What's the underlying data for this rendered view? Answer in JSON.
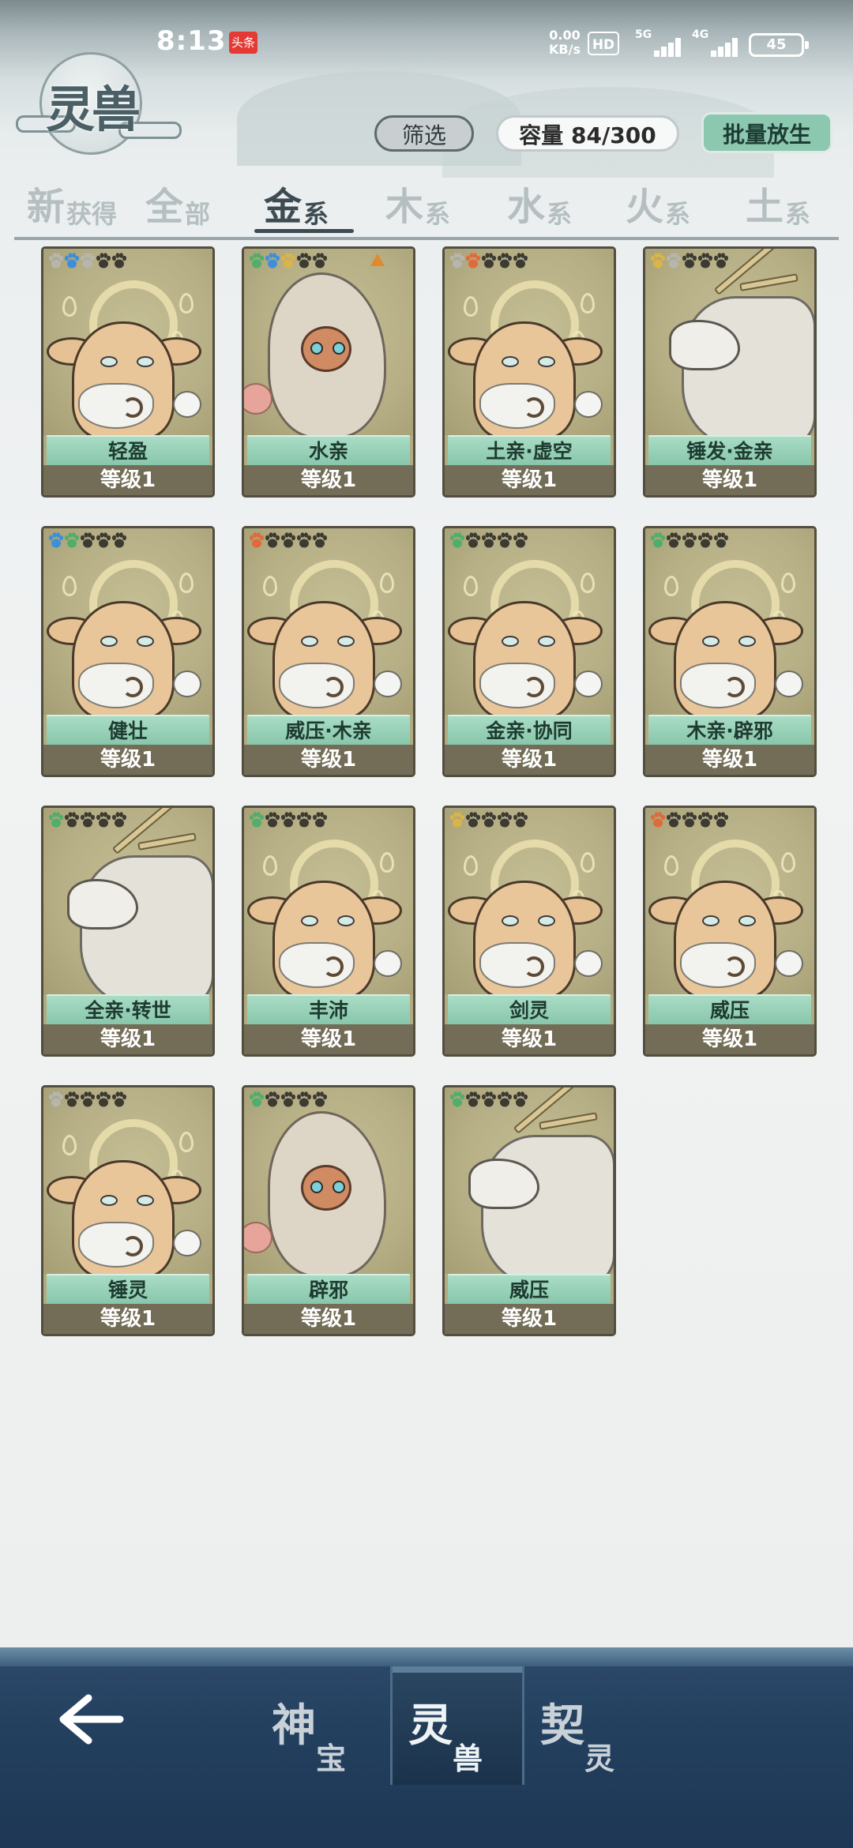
{
  "status_bar": {
    "time": "8:13",
    "news_badge": "头条",
    "net_speed_value": "0.00",
    "net_speed_unit": "KB/s",
    "hd": "HD",
    "signal_1": "5G",
    "signal_2": "4G",
    "battery": "45"
  },
  "header": {
    "title": "灵兽",
    "filter_label": "筛选",
    "capacity_label": "容量 84/300",
    "batch_release_label": "批量放生"
  },
  "tabs": [
    {
      "big": "新",
      "small": "获得",
      "active": false
    },
    {
      "big": "全",
      "small": "部",
      "active": false
    },
    {
      "big": "金",
      "small": "系",
      "active": true
    },
    {
      "big": "木",
      "small": "系",
      "active": false
    },
    {
      "big": "水",
      "small": "系",
      "active": false
    },
    {
      "big": "火",
      "small": "系",
      "active": false
    },
    {
      "big": "土",
      "small": "系",
      "active": false
    }
  ],
  "colors": {
    "gold": "#d9b44a",
    "wood": "#4fae6a",
    "water": "#3c8fd8",
    "fire": "#e06a3a",
    "earth": "#b6b6b0",
    "empty": "#3b3a33"
  },
  "cards": [
    {
      "name": "轻盈",
      "level": "等级1",
      "beast": "rabbit",
      "paws": [
        "earth",
        "water",
        "earth",
        "empty",
        "empty"
      ],
      "triangle": false
    },
    {
      "name": "水亲",
      "level": "等级1",
      "beast": "monkey",
      "paws": [
        "wood",
        "water",
        "gold",
        "empty",
        "empty"
      ],
      "triangle": true
    },
    {
      "name": "土亲·虚空",
      "level": "等级1",
      "beast": "rabbit",
      "paws": [
        "earth",
        "fire",
        "empty",
        "empty",
        "empty"
      ],
      "triangle": false
    },
    {
      "name": "锤发·金亲",
      "level": "等级1",
      "beast": "qilin",
      "paws": [
        "gold",
        "earth",
        "empty",
        "empty",
        "empty"
      ],
      "triangle": false
    },
    {
      "name": "健壮",
      "level": "等级1",
      "beast": "rabbit",
      "paws": [
        "water",
        "wood",
        "empty",
        "empty",
        "empty"
      ],
      "triangle": false
    },
    {
      "name": "威压·木亲",
      "level": "等级1",
      "beast": "rabbit",
      "paws": [
        "fire",
        "empty",
        "empty",
        "empty",
        "empty"
      ],
      "triangle": false
    },
    {
      "name": "金亲·协同",
      "level": "等级1",
      "beast": "rabbit",
      "paws": [
        "wood",
        "empty",
        "empty",
        "empty",
        "empty"
      ],
      "triangle": false
    },
    {
      "name": "木亲·辟邪",
      "level": "等级1",
      "beast": "rabbit",
      "paws": [
        "wood",
        "empty",
        "empty",
        "empty",
        "empty"
      ],
      "triangle": false
    },
    {
      "name": "全亲·转世",
      "level": "等级1",
      "beast": "qilin",
      "paws": [
        "wood",
        "empty",
        "empty",
        "empty",
        "empty"
      ],
      "triangle": false
    },
    {
      "name": "丰沛",
      "level": "等级1",
      "beast": "rabbit",
      "paws": [
        "wood",
        "empty",
        "empty",
        "empty",
        "empty"
      ],
      "triangle": false
    },
    {
      "name": "剑灵",
      "level": "等级1",
      "beast": "rabbit",
      "paws": [
        "gold",
        "empty",
        "empty",
        "empty",
        "empty"
      ],
      "triangle": false
    },
    {
      "name": "威压",
      "level": "等级1",
      "beast": "rabbit",
      "paws": [
        "fire",
        "empty",
        "empty",
        "empty",
        "empty"
      ],
      "triangle": false
    },
    {
      "name": "锤灵",
      "level": "等级1",
      "beast": "rabbit",
      "paws": [
        "earth",
        "empty",
        "empty",
        "empty",
        "empty"
      ],
      "triangle": false
    },
    {
      "name": "辟邪",
      "level": "等级1",
      "beast": "monkey",
      "paws": [
        "wood",
        "empty",
        "empty",
        "empty",
        "empty"
      ],
      "triangle": false
    },
    {
      "name": "威压",
      "level": "等级1",
      "beast": "qilin",
      "paws": [
        "wood",
        "empty",
        "empty",
        "empty",
        "empty"
      ],
      "triangle": false
    }
  ],
  "bottom_nav": {
    "back_icon": "arrow-left-icon",
    "items": [
      {
        "c1": "神",
        "c2": "宝",
        "active": false
      },
      {
        "c1": "灵",
        "c2": "兽",
        "active": true
      },
      {
        "c1": "契",
        "c2": "灵",
        "active": false
      }
    ]
  }
}
